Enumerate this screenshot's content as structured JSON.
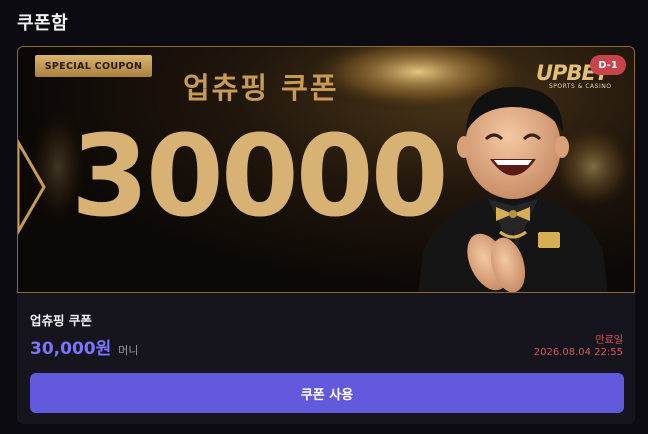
{
  "page": {
    "title": "쿠폰함"
  },
  "coupon": {
    "banner": {
      "tag": "SPECIAL COUPON",
      "heading": "업츄핑 쿠폰",
      "big_amount": "30000",
      "brand": "UPBET",
      "brand_sub": "SPORTS & CASINO",
      "d_day": "D-1"
    },
    "name": "업츄핑 쿠폰",
    "amount": "30,000원",
    "amount_unit": "머니",
    "expiry_label": "만료일",
    "expiry_date": "2026.08.04 22:55",
    "use_button": "쿠폰 사용"
  },
  "colors": {
    "accent": "#6259dd",
    "amount": "#7b74ff",
    "expiry": "#d9545b",
    "gold": "#d8b275"
  }
}
